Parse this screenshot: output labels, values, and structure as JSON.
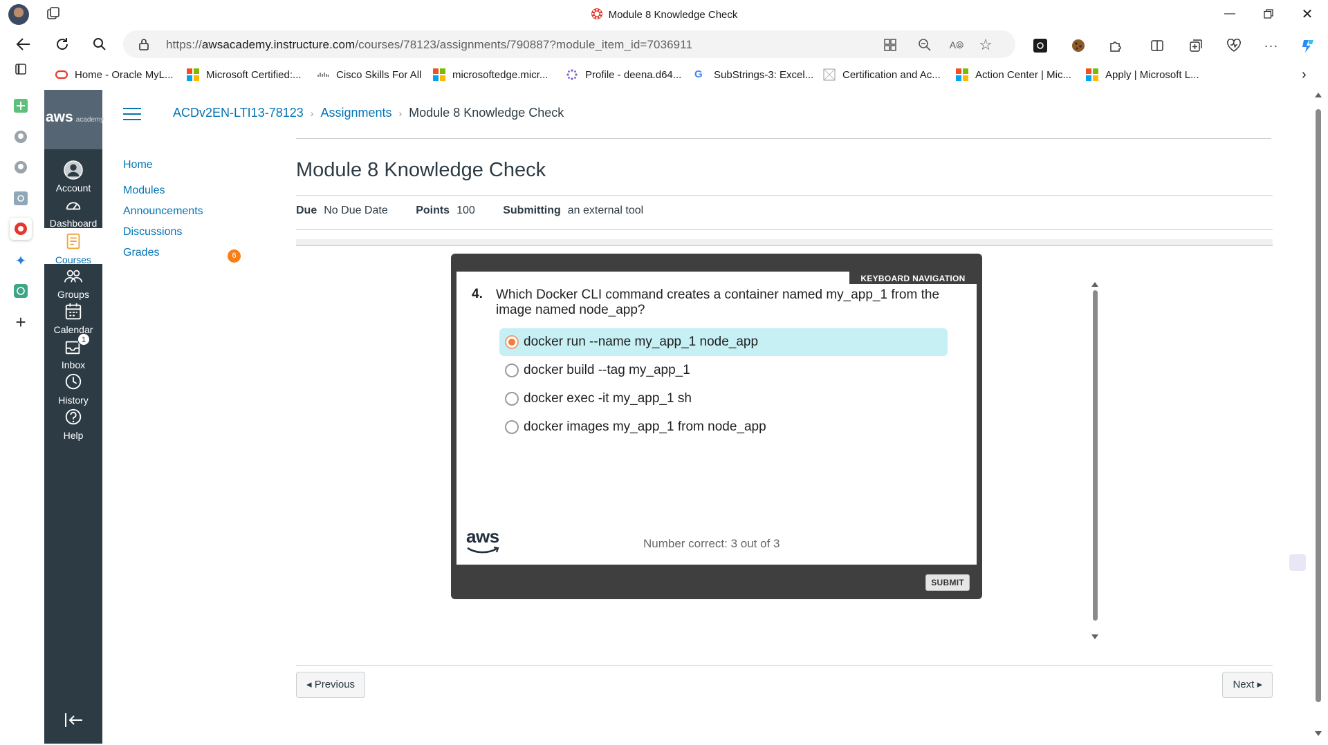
{
  "browser": {
    "window_title": "Module 8 Knowledge Check",
    "url_prefix": "https://",
    "url_domain": "awsacademy.instructure.com",
    "url_path": "/courses/78123/assignments/790887?module_item_id=7036911",
    "bookmarks": [
      {
        "label": "Home - Oracle MyL...",
        "icon": "oracle-icon"
      },
      {
        "label": "Microsoft Certified:...",
        "icon": "microsoft-icon"
      },
      {
        "label": "Cisco Skills For All",
        "icon": "cisco-icon"
      },
      {
        "label": "microsoftedge.micr...",
        "icon": "microsoft-icon"
      },
      {
        "label": "Profile - deena.d64...",
        "icon": "profile-icon"
      },
      {
        "label": "SubStrings-3: Excel...",
        "icon": "google-icon"
      },
      {
        "label": "Certification and Ac...",
        "icon": "certificate-icon"
      },
      {
        "label": "Action Center | Mic...",
        "icon": "microsoft-icon"
      },
      {
        "label": "Apply | Microsoft L...",
        "icon": "microsoft-icon"
      }
    ]
  },
  "global_nav": {
    "brand": "aws",
    "brand_sub": "academy",
    "items": [
      {
        "label": "Account",
        "icon": "account-icon"
      },
      {
        "label": "Dashboard",
        "icon": "dashboard-icon"
      },
      {
        "label": "Courses",
        "icon": "courses-icon",
        "active": true
      },
      {
        "label": "Groups",
        "icon": "groups-icon"
      },
      {
        "label": "Calendar",
        "icon": "calendar-icon"
      },
      {
        "label": "Inbox",
        "icon": "inbox-icon",
        "badge": "1"
      },
      {
        "label": "History",
        "icon": "history-icon"
      },
      {
        "label": "Help",
        "icon": "help-icon"
      }
    ]
  },
  "breadcrumb": {
    "course": "ACDv2EN-LTI13-78123",
    "section": "Assignments",
    "current": "Module 8 Knowledge Check"
  },
  "course_nav": [
    {
      "label": "Home"
    },
    {
      "label": "Modules"
    },
    {
      "label": "Announcements"
    },
    {
      "label": "Discussions"
    },
    {
      "label": "Grades",
      "badge": "6"
    }
  ],
  "assignment": {
    "title": "Module 8 Knowledge Check",
    "due_label": "Due",
    "due_value": "No Due Date",
    "points_label": "Points",
    "points_value": "100",
    "submitting_label": "Submitting",
    "submitting_value": "an external tool"
  },
  "quiz": {
    "keyboard_nav": "KEYBOARD NAVIGATION",
    "question_number": "4.",
    "question_text": "Which Docker CLI command creates a container named my_app_1 from the image named node_app?",
    "options": [
      {
        "text": "docker run --name my_app_1 node_app",
        "selected": true
      },
      {
        "text": "docker build --tag my_app_1",
        "selected": false
      },
      {
        "text": "docker exec -it my_app_1 sh",
        "selected": false
      },
      {
        "text": "docker images my_app_1 from node_app",
        "selected": false
      }
    ],
    "score_text": "Number correct: 3 out of 3",
    "submit_label": "SUBMIT",
    "logo_text": "aws"
  },
  "pager": {
    "previous_label": "◂ Previous",
    "next_label": "Next ▸"
  },
  "colors": {
    "canvas_nav_bg": "#2d3b45",
    "link_blue": "#0374b5",
    "selected_option_bg": "#c7f0f5",
    "radio_orange": "#f07d39",
    "grades_badge": "#f97e14",
    "quiz_frame": "#3f3f3f"
  }
}
